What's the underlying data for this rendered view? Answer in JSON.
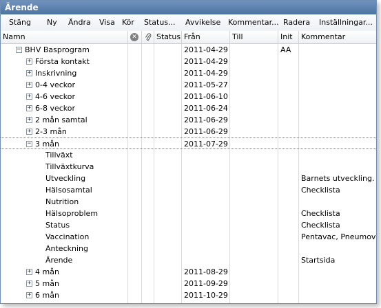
{
  "window": {
    "title": "Ärende"
  },
  "toolbar": {
    "items": [
      {
        "label": "Stäng"
      },
      {
        "label": "Ny"
      },
      {
        "label": "Ändra"
      },
      {
        "label": "Visa"
      },
      {
        "label": "Kör"
      },
      {
        "label": "Status..."
      },
      {
        "label": "Avvikelse"
      },
      {
        "label": "Kommentar..."
      },
      {
        "label": "Radera"
      },
      {
        "label": "Inställningar..."
      }
    ]
  },
  "columns": {
    "namn": "Namn",
    "status": "Status",
    "fran": "Från",
    "till": "Till",
    "init": "Init",
    "kommentar": "Kommentar"
  },
  "icons": {
    "remove": "close-circle-icon",
    "attachment": "paperclip-icon"
  },
  "rows": [
    {
      "name": "BHV Basprogram",
      "level": 0,
      "expander": "minus",
      "from": "2011-04-29",
      "init": "AA",
      "comment": ""
    },
    {
      "name": "Första kontakt",
      "level": 1,
      "expander": "plus",
      "from": "2011-04-29",
      "init": "",
      "comment": ""
    },
    {
      "name": "Inskrivning",
      "level": 1,
      "expander": "plus",
      "from": "2011-04-29",
      "init": "",
      "comment": ""
    },
    {
      "name": "0-4 veckor",
      "level": 1,
      "expander": "plus",
      "from": "2011-05-27",
      "init": "",
      "comment": ""
    },
    {
      "name": "4-6 veckor",
      "level": 1,
      "expander": "plus",
      "from": "2011-06-10",
      "init": "",
      "comment": ""
    },
    {
      "name": "6-8 veckor",
      "level": 1,
      "expander": "plus",
      "from": "2011-06-24",
      "init": "",
      "comment": ""
    },
    {
      "name": "2 mån samtal",
      "level": 1,
      "expander": "plus",
      "from": "2011-06-29",
      "init": "",
      "comment": ""
    },
    {
      "name": "2-3 mån",
      "level": 1,
      "expander": "plus",
      "from": "2011-06-29",
      "init": "",
      "comment": ""
    },
    {
      "name": "3 mån",
      "level": 1,
      "expander": "minus",
      "from": "2011-07-29",
      "init": "",
      "comment": "",
      "selected": true
    },
    {
      "name": "Tillväxt",
      "level": 2,
      "expander": "",
      "from": "",
      "init": "",
      "comment": ""
    },
    {
      "name": "Tillväxtkurva",
      "level": 2,
      "expander": "",
      "from": "",
      "init": "",
      "comment": ""
    },
    {
      "name": "Utveckling",
      "level": 2,
      "expander": "",
      "from": "",
      "init": "",
      "comment": "Barnets utveckling. St..."
    },
    {
      "name": "Hälsosamtal",
      "level": 2,
      "expander": "",
      "from": "",
      "init": "",
      "comment": "Checklista"
    },
    {
      "name": "Nutrition",
      "level": 2,
      "expander": "",
      "from": "",
      "init": "",
      "comment": ""
    },
    {
      "name": "Hälsoproblem",
      "level": 2,
      "expander": "",
      "from": "",
      "init": "",
      "comment": "Checklista"
    },
    {
      "name": "Status",
      "level": 2,
      "expander": "",
      "from": "",
      "init": "",
      "comment": "Checklista"
    },
    {
      "name": "Vaccination",
      "level": 2,
      "expander": "",
      "from": "",
      "init": "",
      "comment": "Pentavac, Pneumovax"
    },
    {
      "name": "Anteckning",
      "level": 2,
      "expander": "",
      "from": "",
      "init": "",
      "comment": ""
    },
    {
      "name": "Ärende",
      "level": 2,
      "expander": "",
      "from": "",
      "init": "",
      "comment": "Startsida"
    },
    {
      "name": "4 mån",
      "level": 1,
      "expander": "plus",
      "from": "2011-08-29",
      "init": "",
      "comment": ""
    },
    {
      "name": "5 mån",
      "level": 1,
      "expander": "plus",
      "from": "2011-09-29",
      "init": "",
      "comment": ""
    },
    {
      "name": "6 mån",
      "level": 1,
      "expander": "plus",
      "from": "2011-10-29",
      "init": "",
      "comment": ""
    }
  ]
}
